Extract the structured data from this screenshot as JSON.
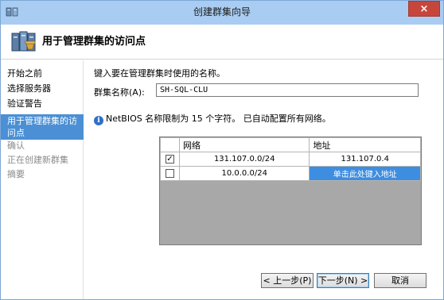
{
  "window": {
    "title": "创建群集向导",
    "close_glyph": "×",
    "accent": "#4b8fd4"
  },
  "header": {
    "title": "用于管理群集的访问点",
    "icon": "cluster-wizard-icon"
  },
  "sidebar": {
    "items": [
      {
        "label": "开始之前",
        "state": "completed"
      },
      {
        "label": "选择服务器",
        "state": "completed"
      },
      {
        "label": "验证警告",
        "state": "completed"
      },
      {
        "label": "用于管理群集的访问点",
        "state": "active"
      },
      {
        "label": "确认",
        "state": "pending"
      },
      {
        "label": "正在创建新群集",
        "state": "pending"
      },
      {
        "label": "摘要",
        "state": "pending"
      }
    ]
  },
  "main": {
    "instruction": "键入要在管理群集时使用的名称。",
    "name_label": "群集名称(A):",
    "name_value": "SH-SQL-CLU",
    "info_text": "NetBIOS 名称限制为 15 个字符。 已自动配置所有网络。",
    "info_icon": "info-icon",
    "networks": {
      "columns": [
        "网络",
        "地址"
      ],
      "rows": [
        {
          "checked": true,
          "network": "131.107.0.0/24",
          "address": "131.107.0.4",
          "check_glyph": "✓"
        },
        {
          "checked": false,
          "network": "10.0.0.0/24",
          "address": "单击此处键入地址",
          "check_glyph": ""
        }
      ]
    }
  },
  "footer": {
    "prev_label": "< 上一步(P)",
    "next_label": "下一步(N) >",
    "cancel_label": "取消"
  }
}
